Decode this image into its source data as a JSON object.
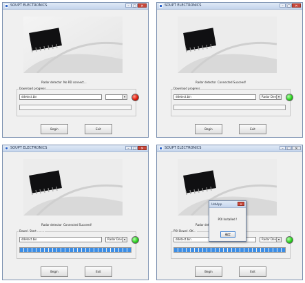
{
  "colors": {
    "accent": "#3c8ee6",
    "led_red": "#e01a0a",
    "led_green": "#2bd11f"
  },
  "windows": [
    {
      "title": "SOUPT ELECTRONICS",
      "status_label": "Radar detector",
      "status_value": "No RD connect...",
      "group_title": "Download progress",
      "file_value": "ddetect.bin",
      "device_value": "",
      "led_status": "red",
      "progress_fraction": 0,
      "begin_label": "Begin",
      "exit_label": "Exit"
    },
    {
      "title": "SOUPT ELECTRONICS",
      "status_label": "Radar detector",
      "status_value": "Connected Succeed!",
      "group_title": "Download progress",
      "file_value": "ddetect.bin",
      "device_value": "Radar Device",
      "led_status": "green",
      "progress_fraction": 0,
      "begin_label": "Begin",
      "exit_label": "Exit"
    },
    {
      "title": "SOUPT ELECTRONICS",
      "status_label": "Radar detector",
      "status_value": "Connected Succeed!",
      "group_title": "Downl. Start ........",
      "file_value": "ddetect.bin",
      "device_value": "Radar Device",
      "led_status": "green",
      "progress_fraction": 1,
      "begin_label": "Begin",
      "exit_label": "Exit"
    },
    {
      "title": "SOUPT ELECTRONICS",
      "status_label": "Radar detector",
      "status_value": "",
      "group_title": "POI Downl. OK...",
      "file_value": "ddetect.bin",
      "device_value": "Radar Device",
      "led_status": "green",
      "progress_fraction": 1,
      "begin_label": "Begin",
      "exit_label": "Exit",
      "dialog": {
        "title": "UsbApp",
        "message": "POI Installed !",
        "ok_label": "确定"
      }
    }
  ]
}
